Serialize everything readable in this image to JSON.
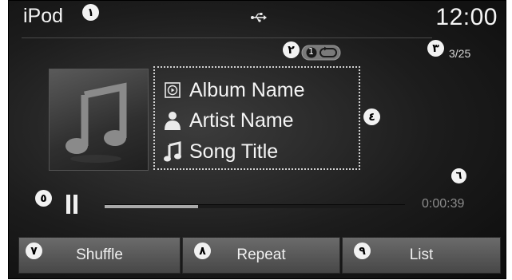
{
  "status": {
    "source": "iPod",
    "time": "12:00",
    "track_count": "3/25"
  },
  "now_playing": {
    "album": "Album Name",
    "artist": "Artist Name",
    "song": "Song Title",
    "elapsed": "0:00:39",
    "progress_fraction": 0.31
  },
  "buttons": {
    "shuffle": "Shuffle",
    "repeat": "Repeat",
    "list": "List"
  },
  "repeat_badge": "1",
  "callouts": [
    "١",
    "٢",
    "٣",
    "٤",
    "٥",
    "٦",
    "٧",
    "٨",
    "٩"
  ],
  "icons": {
    "usb": "usb-icon",
    "repeat_one": "repeat-one-icon",
    "album": "album-icon",
    "artist": "artist-icon",
    "song": "music-note-icon",
    "pause": "pause-icon",
    "album_art_placeholder": "music-note-icon"
  },
  "colors": {
    "screen_bg": "#1c1c1c",
    "text": "#f5f5f5",
    "progress_fill": "#a9a9a9",
    "elapsed_text": "#8c8c8c",
    "button_bg": "#5a5a5a"
  }
}
